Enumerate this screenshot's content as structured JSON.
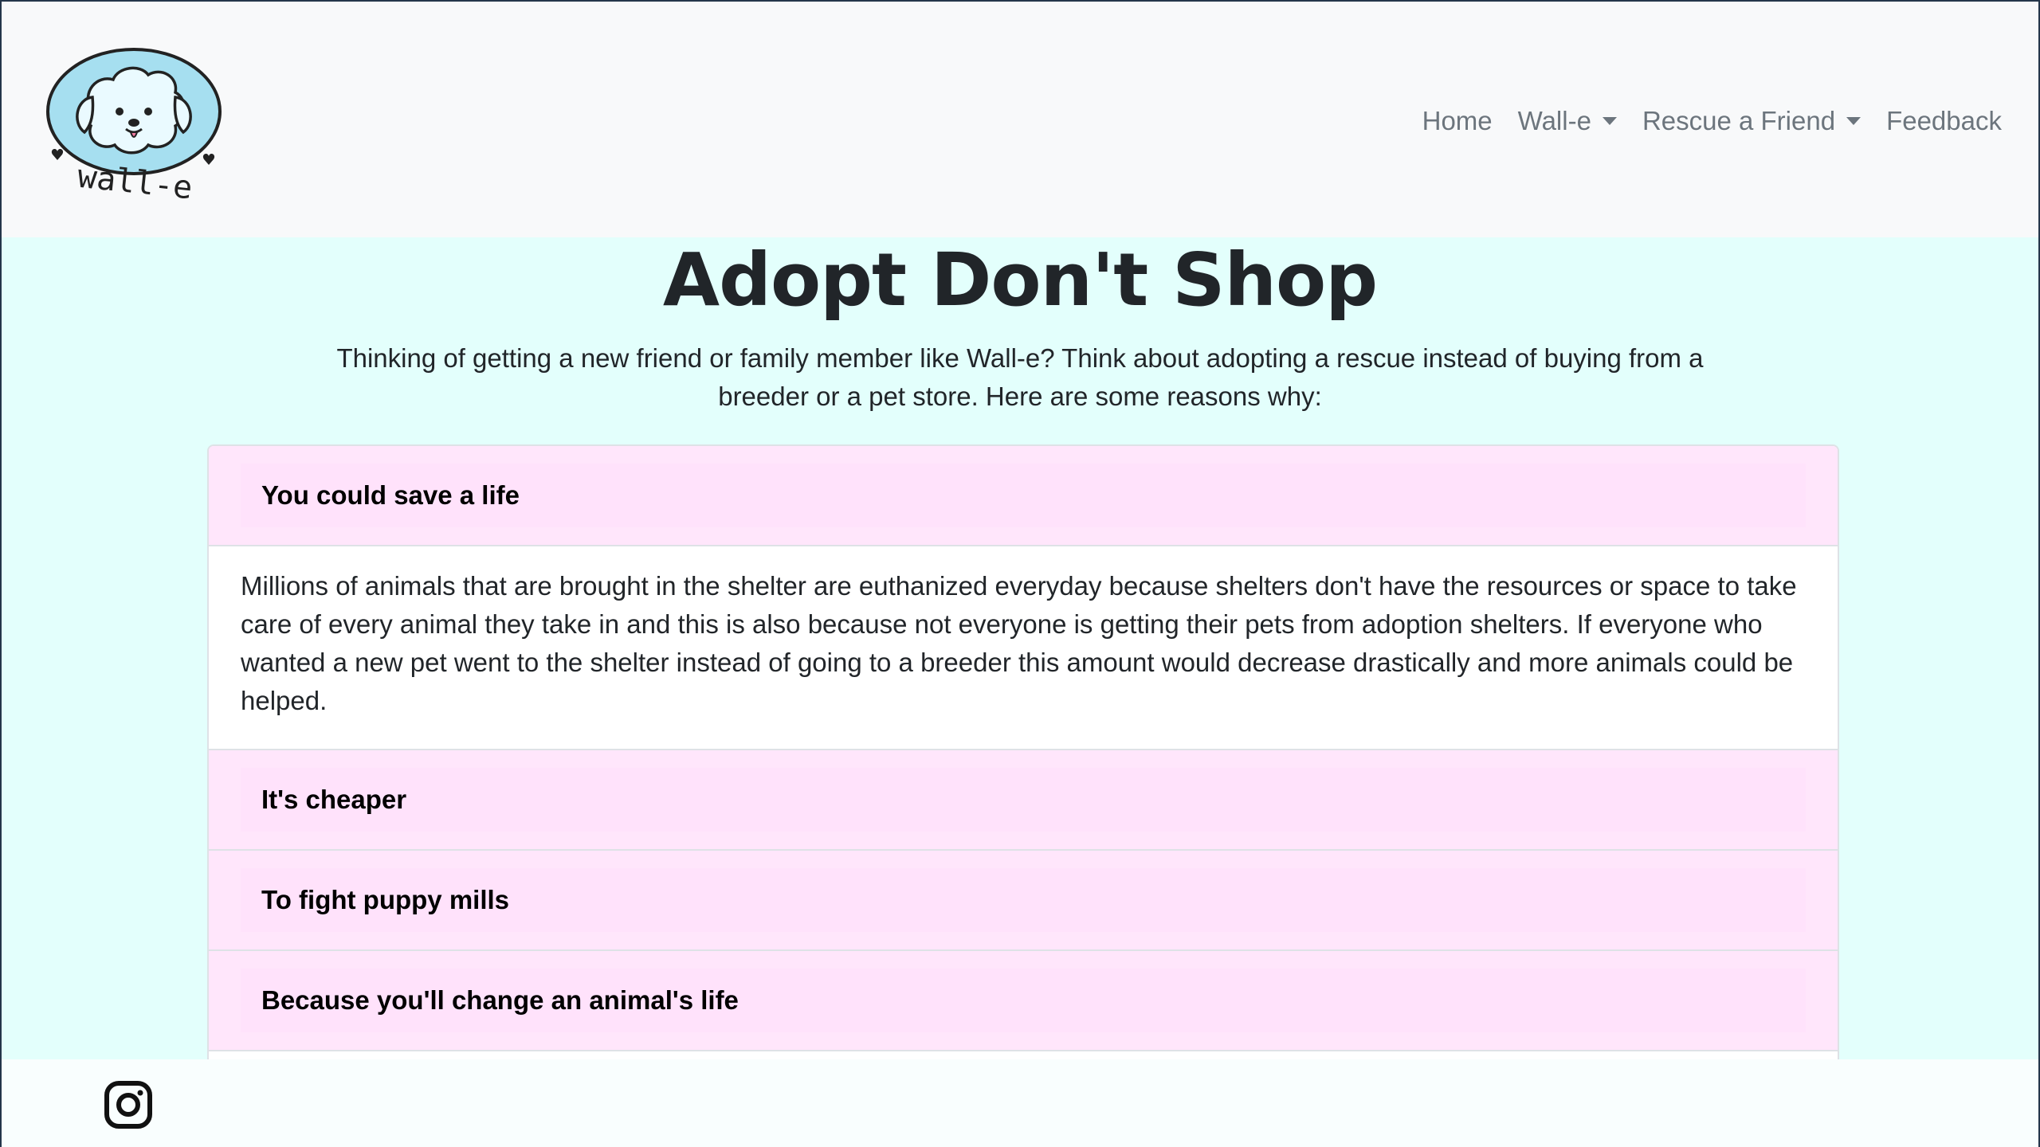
{
  "brand": {
    "logo_text": "wall-e",
    "icon": "dog-logo-icon"
  },
  "nav": {
    "home": "Home",
    "walle": "Wall-e",
    "rescue": "Rescue a Friend",
    "feedback": "Feedback"
  },
  "hero": {
    "title": "Adopt Don't Shop",
    "intro": "Thinking of getting a new friend or family member like Wall-e? Think about adopting a rescue instead of buying from a breeder or a pet store. Here are some reasons why:"
  },
  "accordion": {
    "items": [
      {
        "title": "You could save a life",
        "body": "Millions of animals that are brought in the shelter are euthanized everyday because shelters don't have the resources or space to take care of every animal they take in and this is also because not everyone is getting their pets from adoption shelters. If everyone who wanted a new pet went to the shelter instead of going to a breeder this amount would decrease drastically and more animals could be helped."
      },
      {
        "title": "It's cheaper"
      },
      {
        "title": "To fight puppy mills"
      },
      {
        "title": "Because you'll change an animal's life"
      }
    ]
  },
  "footer": {
    "icon": "instagram-icon"
  },
  "colors": {
    "page_bg": "#e3fffc",
    "navbar_bg": "#f8f9fa",
    "accordion_header_bg": "#ffe2fb",
    "logo_blue": "#a6dff0"
  }
}
